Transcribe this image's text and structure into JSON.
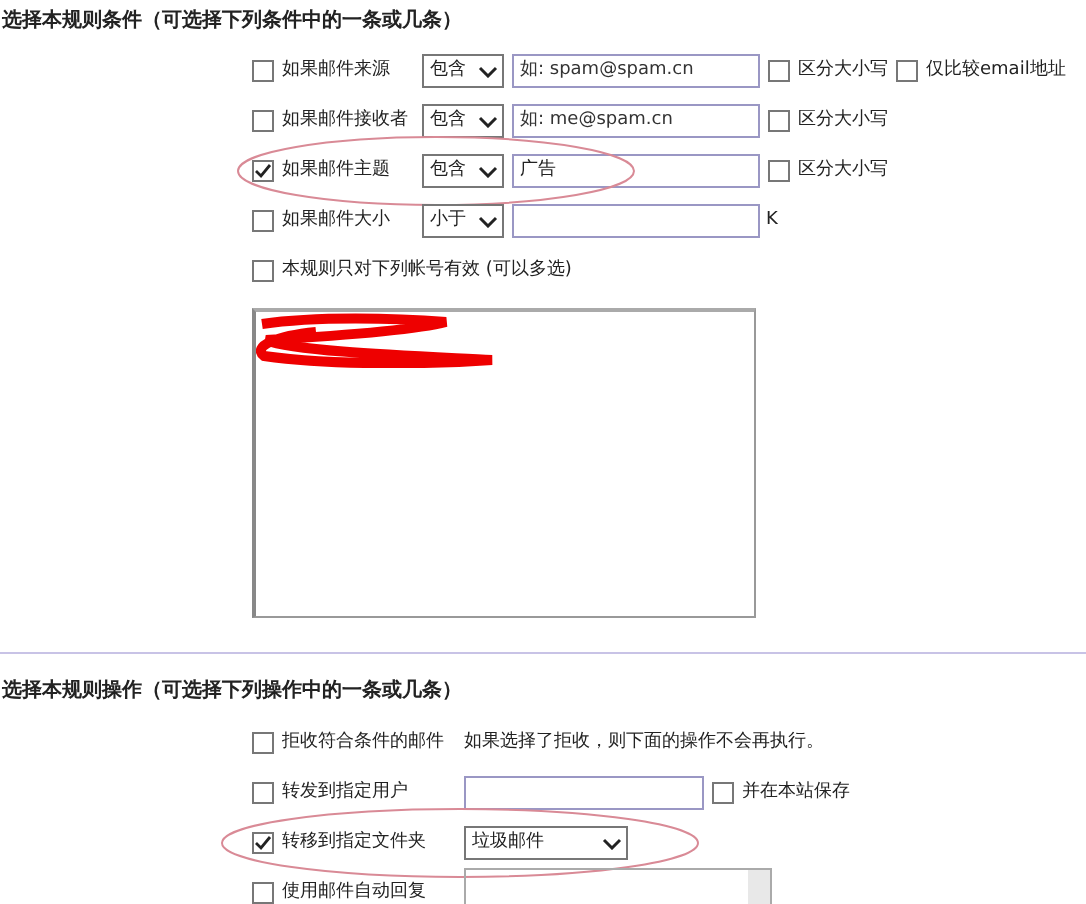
{
  "conditions_section": {
    "title": "选择本规则条件（可选择下列条件中的一条或几条）",
    "rows": [
      {
        "kind": "match",
        "checked": false,
        "highlighted": false,
        "label": "如果邮件来源",
        "operator": "包含",
        "placeholder": "如: spam@spam.cn",
        "options": [
          {
            "label": "区分大小写",
            "checked": false
          },
          {
            "label": "仅比较email地址",
            "checked": false
          }
        ]
      },
      {
        "kind": "match",
        "checked": false,
        "highlighted": false,
        "label": "如果邮件接收者",
        "operator": "包含",
        "placeholder": "如: me@spam.cn",
        "options": [
          {
            "label": "区分大小写",
            "checked": false
          }
        ]
      },
      {
        "kind": "match",
        "checked": true,
        "highlighted": true,
        "label": "如果邮件主题",
        "operator": "包含",
        "value": "广告",
        "options": [
          {
            "label": "区分大小写",
            "checked": false
          }
        ]
      },
      {
        "kind": "size",
        "checked": false,
        "highlighted": false,
        "label": "如果邮件大小",
        "operator": "小于",
        "unit": "K"
      },
      {
        "kind": "plain",
        "checked": false,
        "highlighted": false,
        "label": "本规则只对下列帐号有效 (可以多选)"
      }
    ],
    "account_list": {
      "redacted": true
    }
  },
  "actions_section": {
    "title": "选择本规则操作（可选择下列操作中的一条或几条）",
    "rows": [
      {
        "kind": "note",
        "checked": false,
        "highlighted": false,
        "label": "拒收符合条件的邮件",
        "note": "如果选择了拒收，则下面的操作不会再执行。"
      },
      {
        "kind": "input",
        "checked": false,
        "highlighted": false,
        "label": "转发到指定用户",
        "option": {
          "label": "并在本站保存",
          "checked": false
        }
      },
      {
        "kind": "select",
        "checked": true,
        "highlighted": true,
        "label": "转移到指定文件夹",
        "value": "垃圾邮件"
      },
      {
        "kind": "textarea",
        "checked": false,
        "highlighted": false,
        "label": "使用邮件自动回复"
      }
    ]
  }
}
